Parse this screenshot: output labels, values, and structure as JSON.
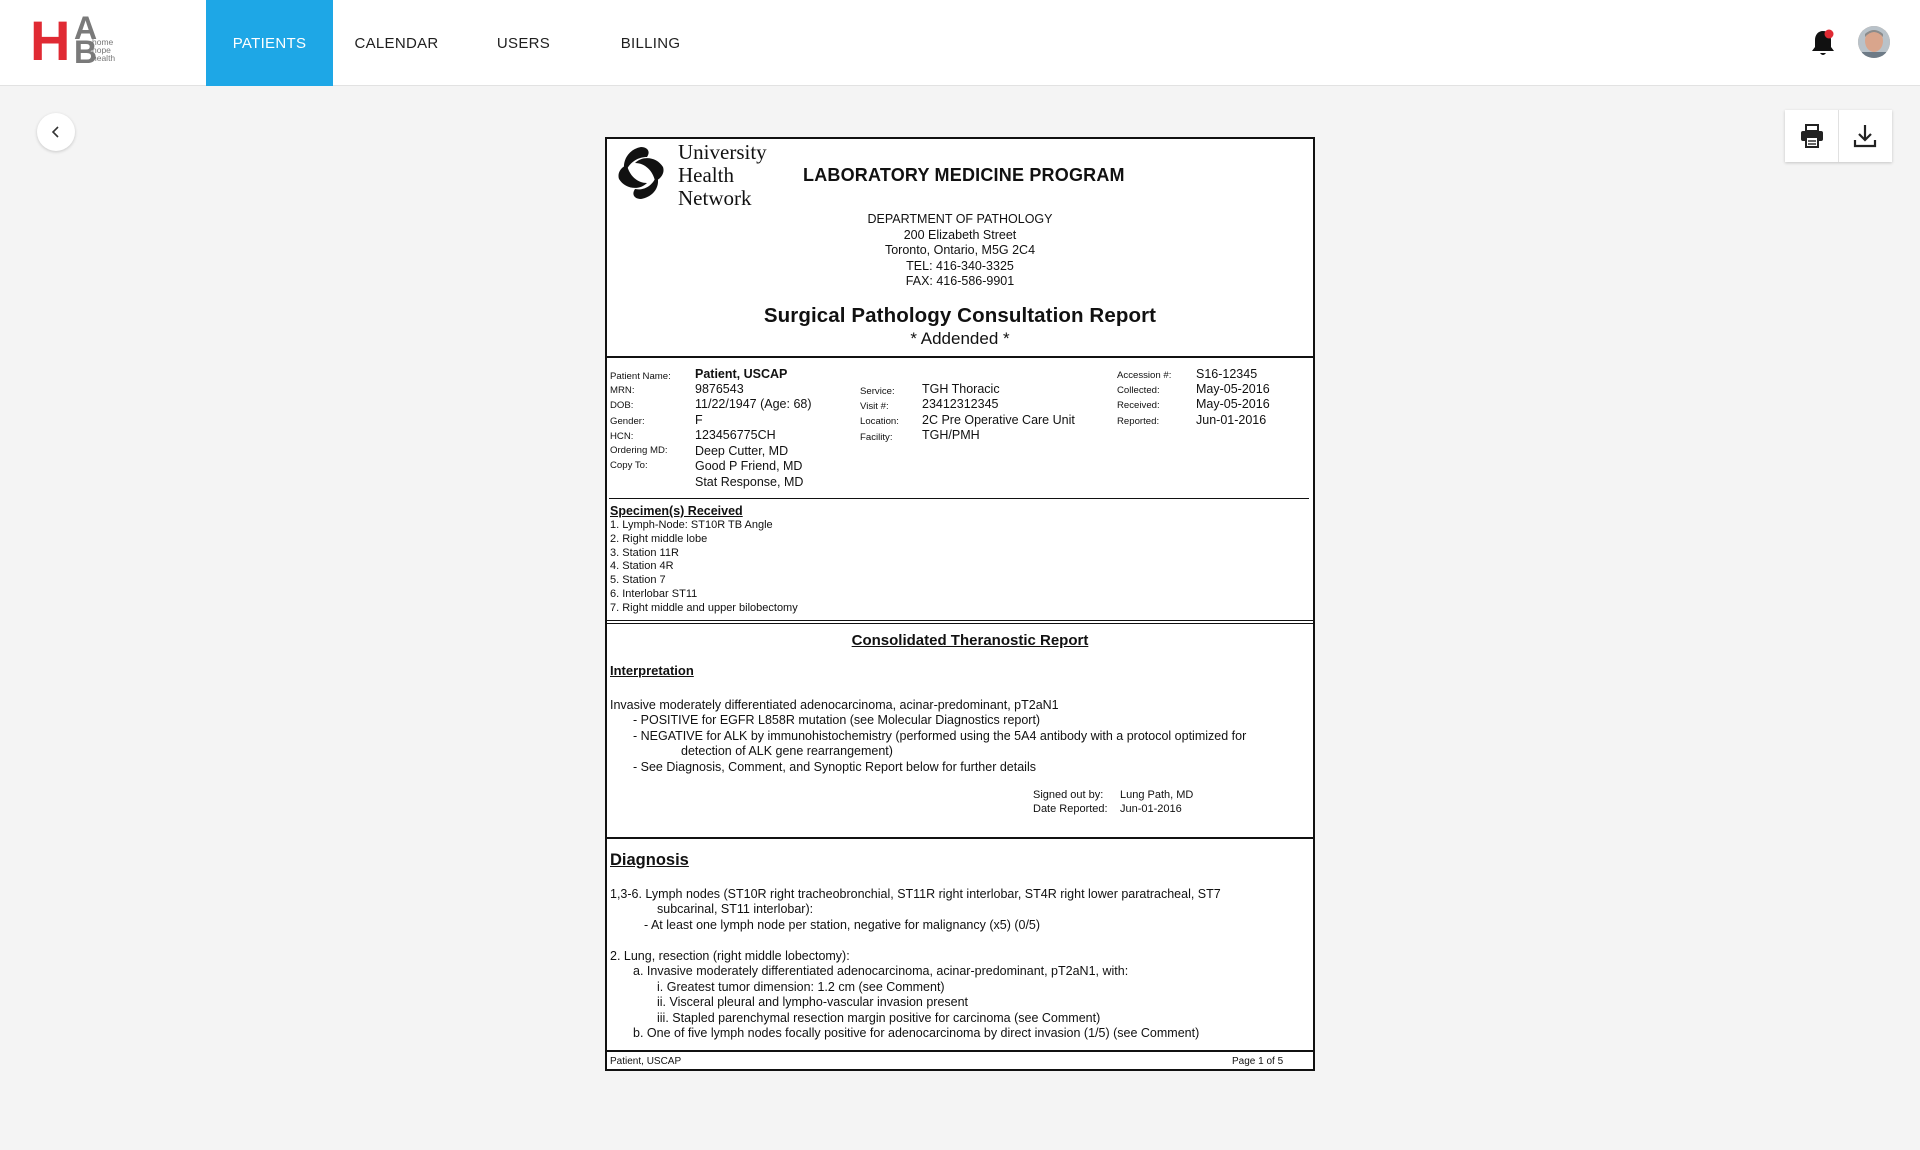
{
  "app": {
    "logo": {
      "letter_h": "H",
      "letter_a": "A",
      "letter_b": "B",
      "tag_1": "home",
      "tag_2": "hope",
      "tag_3": "health"
    },
    "nav": [
      {
        "label": "PATIENTS",
        "active": true
      },
      {
        "label": "CALENDAR",
        "active": false
      },
      {
        "label": "USERS",
        "active": false
      },
      {
        "label": "BILLING",
        "active": false
      }
    ],
    "colors": {
      "accent": "#1ea7e6",
      "logo_red": "#e02a33",
      "notification_dot": "#e02a33"
    },
    "icons": {
      "notifications": "bell-icon",
      "back": "chevron-left-icon",
      "print": "printer-icon",
      "download": "download-icon"
    }
  },
  "report": {
    "institution": [
      "University",
      "Health",
      "Network"
    ],
    "program": "LABORATORY MEDICINE PROGRAM",
    "department": [
      "DEPARTMENT OF PATHOLOGY",
      "200 Elizabeth Street",
      "Toronto, Ontario, M5G 2C4",
      "TEL: 416-340-3325",
      "FAX: 416-586-9901"
    ],
    "title": "Surgical  Pathology Consultation Report",
    "subtitle": "* Addended *",
    "patient": {
      "name_label": "Patient Name:",
      "name": "Patient, USCAP",
      "mrn_label": "MRN:",
      "mrn": "9876543",
      "dob_label": "DOB:",
      "dob": "11/22/1947 (Age: 68)",
      "gender_label": "Gender:",
      "gender": "F",
      "hcn_label": "HCN:",
      "hcn": "123456775CH",
      "ordering_label": "Ordering MD:",
      "ordering": "Deep Cutter, MD",
      "copy_label": "Copy To:",
      "copy_1": "Good P Friend, MD",
      "copy_2": "Stat Response, MD"
    },
    "service": {
      "service_label": "Service:",
      "service": "TGH Thoracic",
      "visit_label": "Visit #:",
      "visit": "23412312345",
      "location_label": "Location:",
      "location": "2C Pre Operative Care Unit",
      "facility_label": "Facility:",
      "facility": "TGH/PMH"
    },
    "accession": {
      "accession_label": "Accession #:",
      "accession": "S16-12345",
      "collected_label": "Collected:",
      "collected": "May-05-2016",
      "received_label": "Received:",
      "received": "May-05-2016",
      "reported_label": "Reported:",
      "reported": "Jun-01-2016"
    },
    "specimens_heading": "Specimen(s)  Received",
    "specimens": [
      "1. Lymph-Node: ST10R TB Angle",
      "2. Right middle lobe",
      "3. Station 11R",
      "4. Station 4R",
      "5. Station 7",
      "6. Interlobar ST11",
      "7. Right middle and upper bilobectomy"
    ],
    "theranostic_heading": "Consolidated Theranostic Report",
    "interpretation_heading": "Interpretation",
    "interpretation_main": "Invasive moderately differentiated adenocarcinoma, acinar-predominant, pT2aN1",
    "interpretation_1": "- POSITIVE for EGFR L858R mutation (see Molecular Diagnostics report)",
    "interpretation_2a": "- NEGATIVE for ALK by immunohistochemistry (performed using the 5A4 antibody with a protocol optimized for",
    "interpretation_2b": "detection of ALK gene rearrangement)",
    "interpretation_3": "- See Diagnosis, Comment, and Synoptic Report below for further details",
    "signed_label": "Signed  out by:",
    "signed": "Lung Path, MD",
    "date_reported_label": "Date Reported:",
    "date_reported": "Jun-01-2016",
    "diagnosis_heading": "Diagnosis",
    "diag_1a": "1,3-6. Lymph nodes (ST10R right tracheobronchial, ST11R right interlobar, ST4R right lower paratracheal, ST7",
    "diag_1b": "subcarinal, ST11 interlobar):",
    "diag_1c": "- At least one lymph node per station, negative for malignancy (x5) (0/5)",
    "diag_2": "2. Lung, resection (right middle lobectomy):",
    "diag_2a": "a. Invasive moderately differentiated adenocarcinoma, acinar-predominant, pT2aN1, with:",
    "diag_2a_i": "i. Greatest tumor dimension: 1.2 cm (see Comment)",
    "diag_2a_ii": "ii. Visceral pleural and lympho-vascular invasion present",
    "diag_2a_iii": "iii. Stapled parenchymal resection margin positive for carcinoma (see Comment)",
    "diag_2b": "b. One of five lymph nodes focally positive for adenocarcinoma by direct invasion (1/5) (see Comment)",
    "footer_patient": "Patient, USCAP",
    "footer_page": "Page 1 of 5"
  }
}
